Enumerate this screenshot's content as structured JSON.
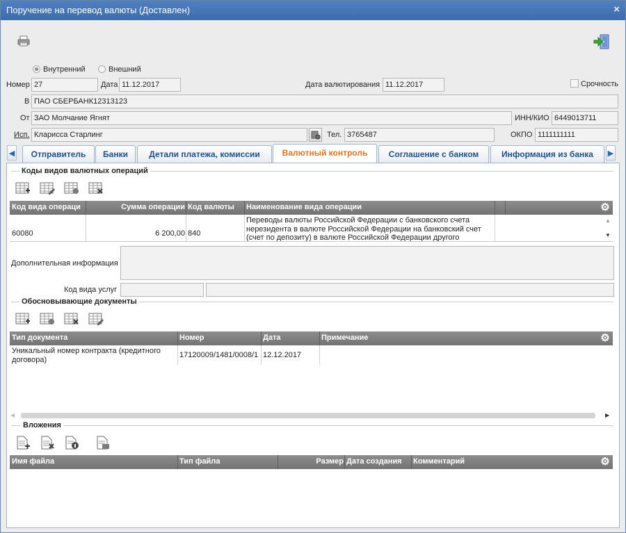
{
  "window": {
    "title": "Поручение на перевод валюты (Доставлен)",
    "close": "×"
  },
  "toolbar": {
    "print_icon": "printer-icon",
    "exit_icon": "exit-door-icon"
  },
  "radio": {
    "internal": "Внутренний",
    "external": "Внешний",
    "selected": "internal"
  },
  "header": {
    "number_label": "Номер",
    "number": "27",
    "date_label": "Дата",
    "date": "11.12.2017",
    "currency_date_label": "Дата валютирования",
    "currency_date": "11.12.2017",
    "urgent_label": "Срочность",
    "to_label": "В",
    "to": "ПАО СБЕРБАНК12313123",
    "from_label": "От",
    "from": "ЗАО Молчание Ягнят",
    "inn_label": "ИНН/КИО",
    "inn": "6449013711",
    "executor_label": "Исп.",
    "executor": "Кларисса Старлинг",
    "phone_label": "Тел.",
    "phone": "3765487",
    "okpo_label": "ОКПО",
    "okpo": "1111111111"
  },
  "tabs": [
    "Отправитель",
    "Банки",
    "Детали платежа, комиссии",
    "Валютный контроль",
    "Соглашение с банком",
    "Информация из банка"
  ],
  "active_tab": "Валютный контроль",
  "ops": {
    "section": "Коды видов валютных операций",
    "columns": [
      "Код вида операци",
      "Сумма операции",
      "Код валюты",
      "Наименование вида операции"
    ],
    "rows": [
      {
        "code": "60080",
        "amount": "6 200,00",
        "currency": "840",
        "name_lines": [
          "Переводы валюты Российской Федерации с банковского счета",
          "нерезидента в валюте Российской Федерации на банковский счет",
          "(счет по депозиту) в валюте Российской Федерации другого"
        ]
      }
    ]
  },
  "extra": {
    "info_label": "Дополнительная информация",
    "service_label": "Код вида услуг"
  },
  "docs": {
    "section": "Обосновывающие документы",
    "columns": [
      "Тип документа",
      "Номер",
      "Дата",
      "Примечание"
    ],
    "rows": [
      {
        "type_lines": [
          "Уникальный номер контракта (кредитного",
          "договора)"
        ],
        "number": "17120009/1481/0008/1",
        "date": "12.12.2017",
        "note": ""
      }
    ]
  },
  "attachments": {
    "section": "Вложения",
    "columns": [
      "Имя файла",
      "Тип файла",
      "Размер",
      "Дата создания",
      "Комментарий"
    ]
  },
  "colors": {
    "title_bar": "#3d6cab",
    "active_tab": "#e0741a",
    "tab_text": "#1f4f8a",
    "grid_header": "#7d7d7d"
  }
}
